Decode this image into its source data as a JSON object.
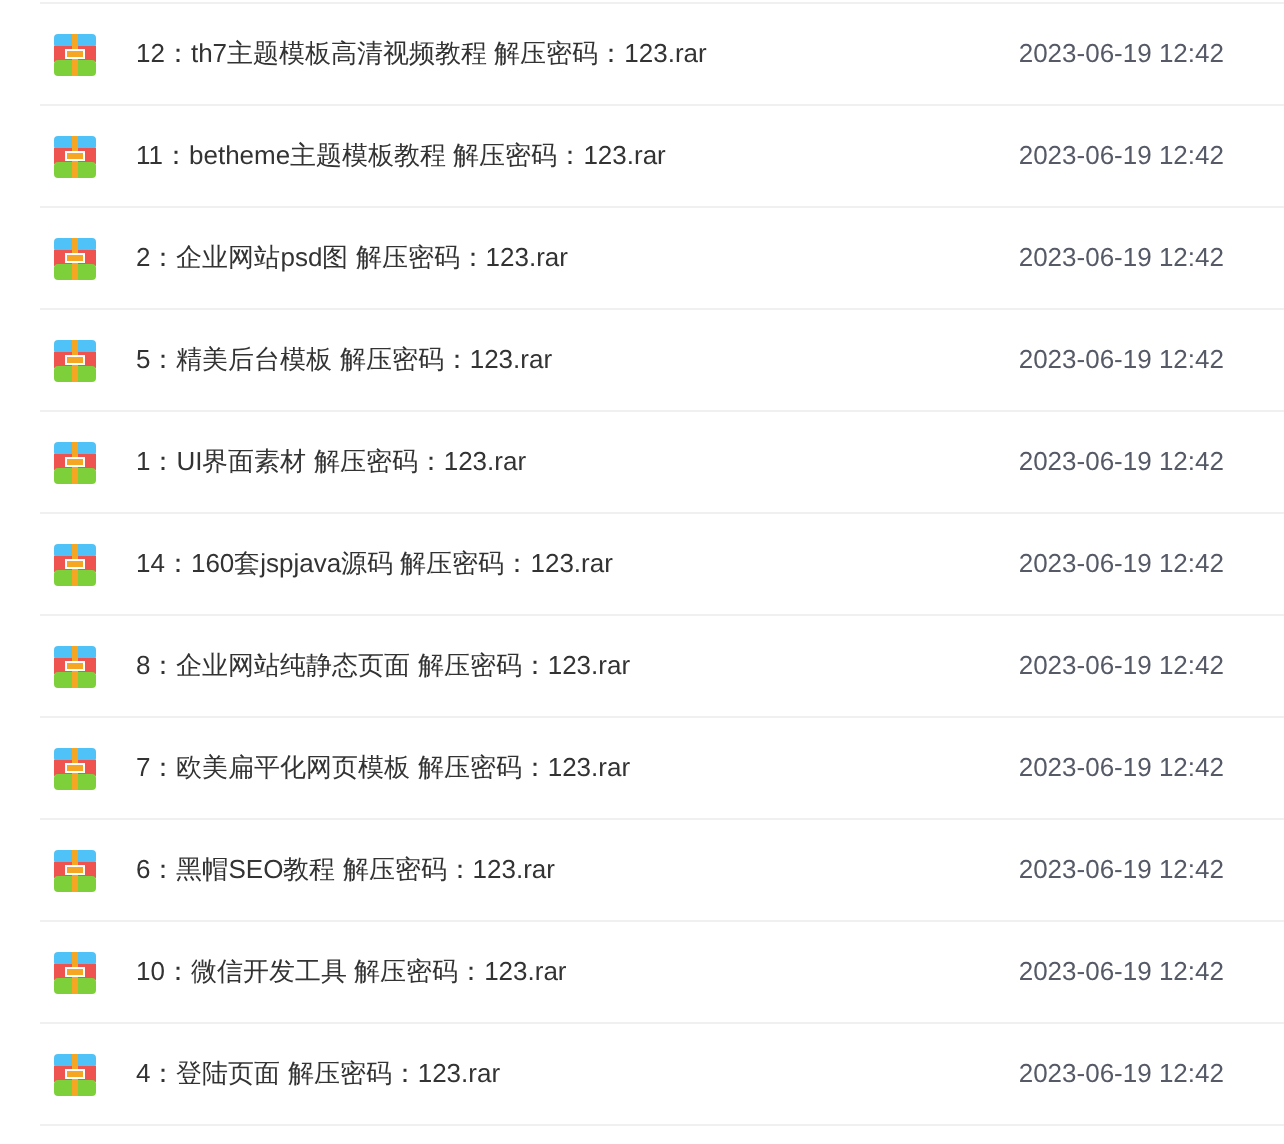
{
  "files": [
    {
      "name": "12：th7主题模板高清视频教程 解压密码：123.rar",
      "date": "2023-06-19 12:42"
    },
    {
      "name": "11：betheme主题模板教程 解压密码：123.rar",
      "date": "2023-06-19 12:42"
    },
    {
      "name": "2：企业网站psd图 解压密码：123.rar",
      "date": "2023-06-19 12:42"
    },
    {
      "name": "5：精美后台模板 解压密码：123.rar",
      "date": "2023-06-19 12:42"
    },
    {
      "name": "1：UI界面素材 解压密码：123.rar",
      "date": "2023-06-19 12:42"
    },
    {
      "name": "14：160套jspjava源码 解压密码：123.rar",
      "date": "2023-06-19 12:42"
    },
    {
      "name": "8：企业网站纯静态页面 解压密码：123.rar",
      "date": "2023-06-19 12:42"
    },
    {
      "name": "7：欧美扁平化网页模板 解压密码：123.rar",
      "date": "2023-06-19 12:42"
    },
    {
      "name": "6：黑帽SEO教程 解压密码：123.rar",
      "date": "2023-06-19 12:42"
    },
    {
      "name": "10：微信开发工具 解压密码：123.rar",
      "date": "2023-06-19 12:42"
    },
    {
      "name": "4：登陆页面 解压密码：123.rar",
      "date": "2023-06-19 12:42"
    }
  ]
}
